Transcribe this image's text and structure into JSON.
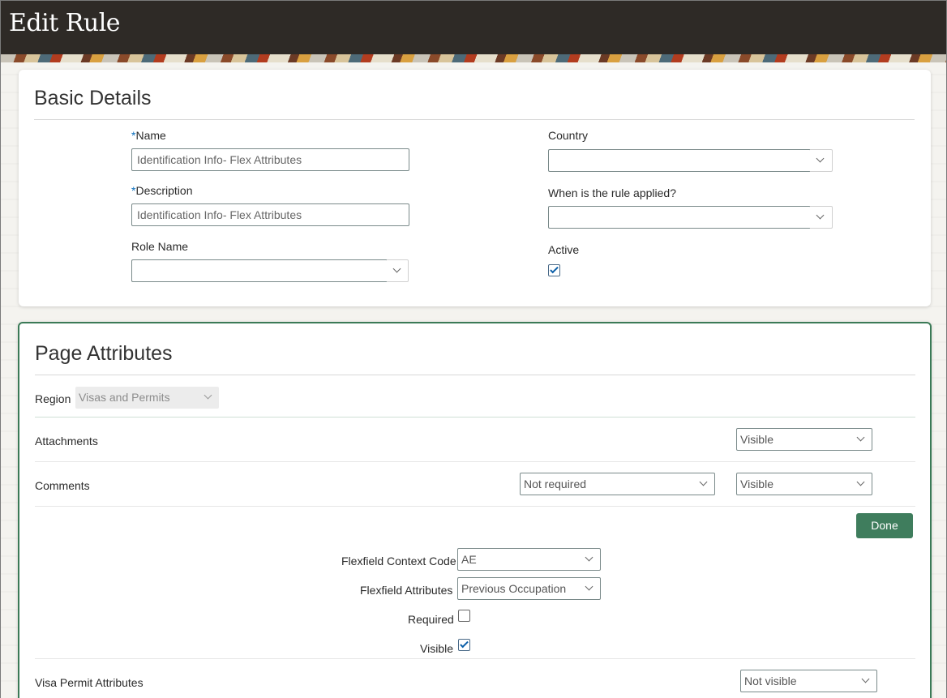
{
  "header": {
    "title": "Edit Rule"
  },
  "basic_details": {
    "title": "Basic Details",
    "name": {
      "label": "Name",
      "required_mark": "*",
      "value": "Identification Info- Flex Attributes"
    },
    "description": {
      "label": "Description",
      "required_mark": "*",
      "value": "Identification Info- Flex Attributes"
    },
    "role_name": {
      "label": "Role Name",
      "value": ""
    },
    "country": {
      "label": "Country",
      "value": ""
    },
    "when_applied": {
      "label": "When is the rule applied?",
      "value": ""
    },
    "active": {
      "label": "Active",
      "checked": true
    }
  },
  "page_attributes": {
    "title": "Page Attributes",
    "region": {
      "label": "Region",
      "value": "Visas and Permits"
    },
    "attachments": {
      "label": "Attachments",
      "visibility": "Visible"
    },
    "comments": {
      "label": "Comments",
      "requirement": "Not required",
      "visibility": "Visible"
    },
    "done_label": "Done",
    "flexfield_context_code": {
      "label": "Flexfield Context Code",
      "value": "AE"
    },
    "flexfield_attributes": {
      "label": "Flexfield Attributes",
      "value": "Previous Occupation"
    },
    "required": {
      "label": "Required",
      "checked": false
    },
    "visible": {
      "label": "Visible",
      "checked": true
    },
    "visa_permit_attributes": {
      "label": "Visa Permit Attributes",
      "visibility": "Not visible"
    }
  },
  "colors": {
    "header_bg": "#2e2a26",
    "accent_green": "#3f7d5d",
    "required_mark": "#0a6ebd"
  }
}
